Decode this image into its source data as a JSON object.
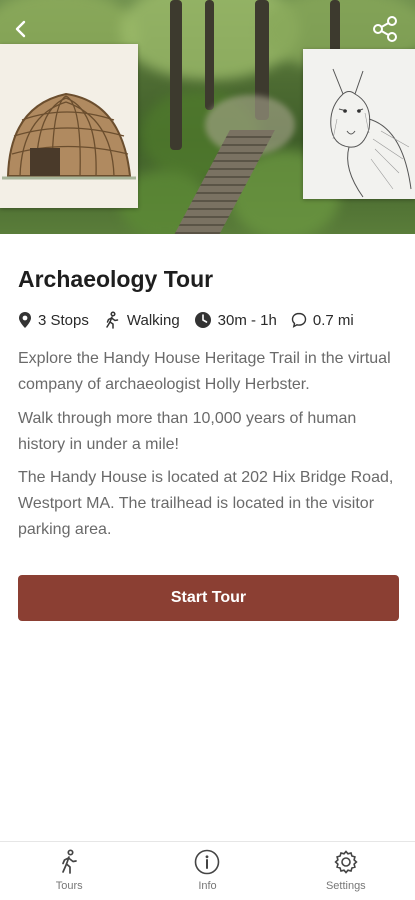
{
  "hero": {
    "back_icon": "chevron-left-icon",
    "share_icon": "share-icon",
    "left_card_subject": "wetu-frame-illustration",
    "right_card_subject": "wolf-sketch"
  },
  "tour": {
    "title": "Archaeology Tour",
    "meta": {
      "stops": "3 Stops",
      "mode": "Walking",
      "duration": "30m - 1h",
      "distance": "0.7 mi"
    },
    "paragraphs": [
      "Explore the Handy House Heritage Trail in the virtual company of archaeologist Holly Herbster.",
      "Walk through more than 10,000 years of human history in under a mile!",
      "The Handy House is located at 202 Hix Bridge Road, Westport MA. The trailhead is located in the visitor parking area."
    ],
    "start_label": "Start Tour"
  },
  "nav": {
    "items": [
      {
        "label": "Tours",
        "icon": "walking-person-icon"
      },
      {
        "label": "Info",
        "icon": "info-icon"
      },
      {
        "label": "Settings",
        "icon": "gear-icon"
      }
    ]
  },
  "colors": {
    "accent": "#8b3f33",
    "body_text": "#6a6a6a",
    "title_text": "#1e1e1e"
  }
}
